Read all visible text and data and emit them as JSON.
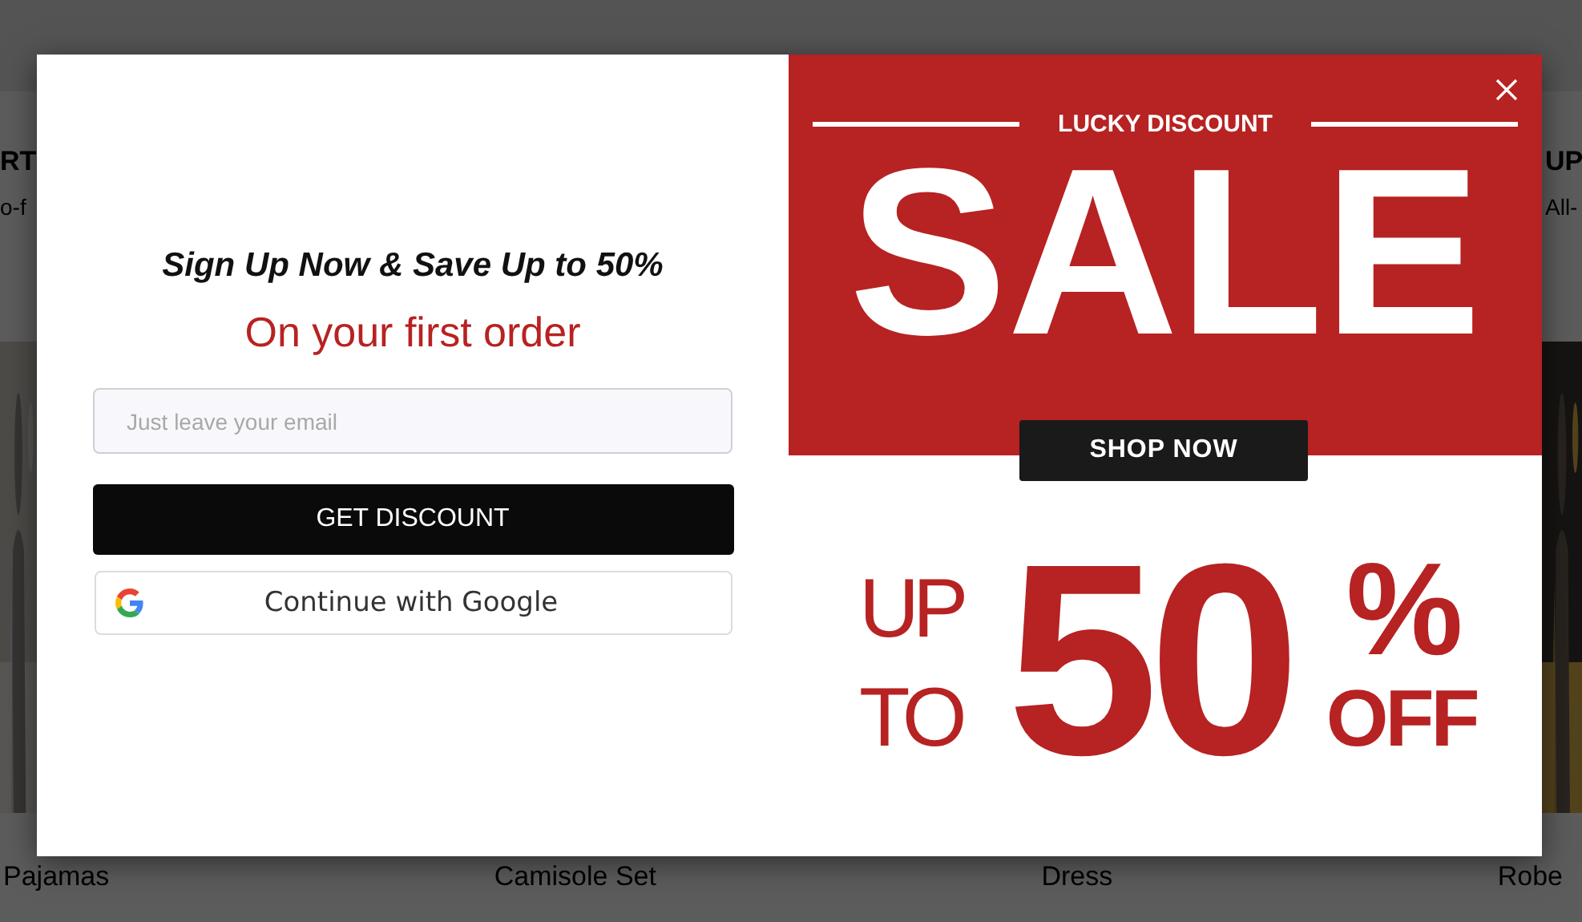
{
  "background_page": {
    "section_left": {
      "title": "RT",
      "subtitle": "o-f"
    },
    "section_right": {
      "title": "UP",
      "subtitle": "All-"
    },
    "products": [
      {
        "name": "Pajamas"
      },
      {
        "name": "Camisole Set"
      },
      {
        "name": "Dress"
      },
      {
        "name": "Robe"
      }
    ]
  },
  "popup": {
    "heading": "Sign Up Now & Save Up to 50%",
    "subheading": "On your first order",
    "email_field": {
      "placeholder": "Just leave your email"
    },
    "submit_button": "GET DISCOUNT",
    "google_button": "Continue with Google",
    "banner": {
      "eyebrow": "LUCKY DISCOUNT",
      "headline": "SALE",
      "shop_button": "SHOP NOW",
      "up_to": [
        "UP",
        "TO"
      ],
      "amount": "50",
      "percent": "%",
      "off": "OFF"
    }
  }
}
